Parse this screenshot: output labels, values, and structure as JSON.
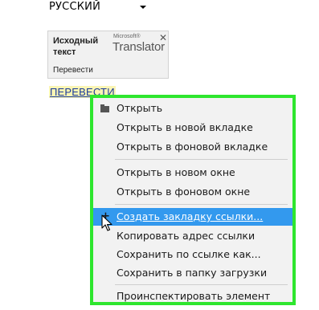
{
  "language_select": {
    "value": "РУССКИЙ"
  },
  "translator_popup": {
    "source_label": "Исходный текст",
    "brand_small": "Microsoft®",
    "brand": "Translator",
    "close_glyph": "✕",
    "translate_text": "Перевести"
  },
  "link": {
    "text": "ПЕРЕВЕСТИ"
  },
  "context_menu": {
    "items": [
      {
        "label": "Открыть"
      },
      {
        "label": "Открыть в новой вкладке"
      },
      {
        "label": "Открыть в фоновой вкладке"
      },
      {
        "label": "Открыть в новом окне"
      },
      {
        "label": "Открыть в фоновом окне"
      },
      {
        "label": "Создать закладку ссылки..."
      },
      {
        "label": "Копировать адрес ссылки"
      },
      {
        "label": "Сохранить по ссылке как..."
      },
      {
        "label": "Сохранить в папку загрузки"
      },
      {
        "label": "Проинспектировать элемент"
      }
    ],
    "highlight_color": "#3399ee",
    "border_color": "#2ee62e"
  }
}
